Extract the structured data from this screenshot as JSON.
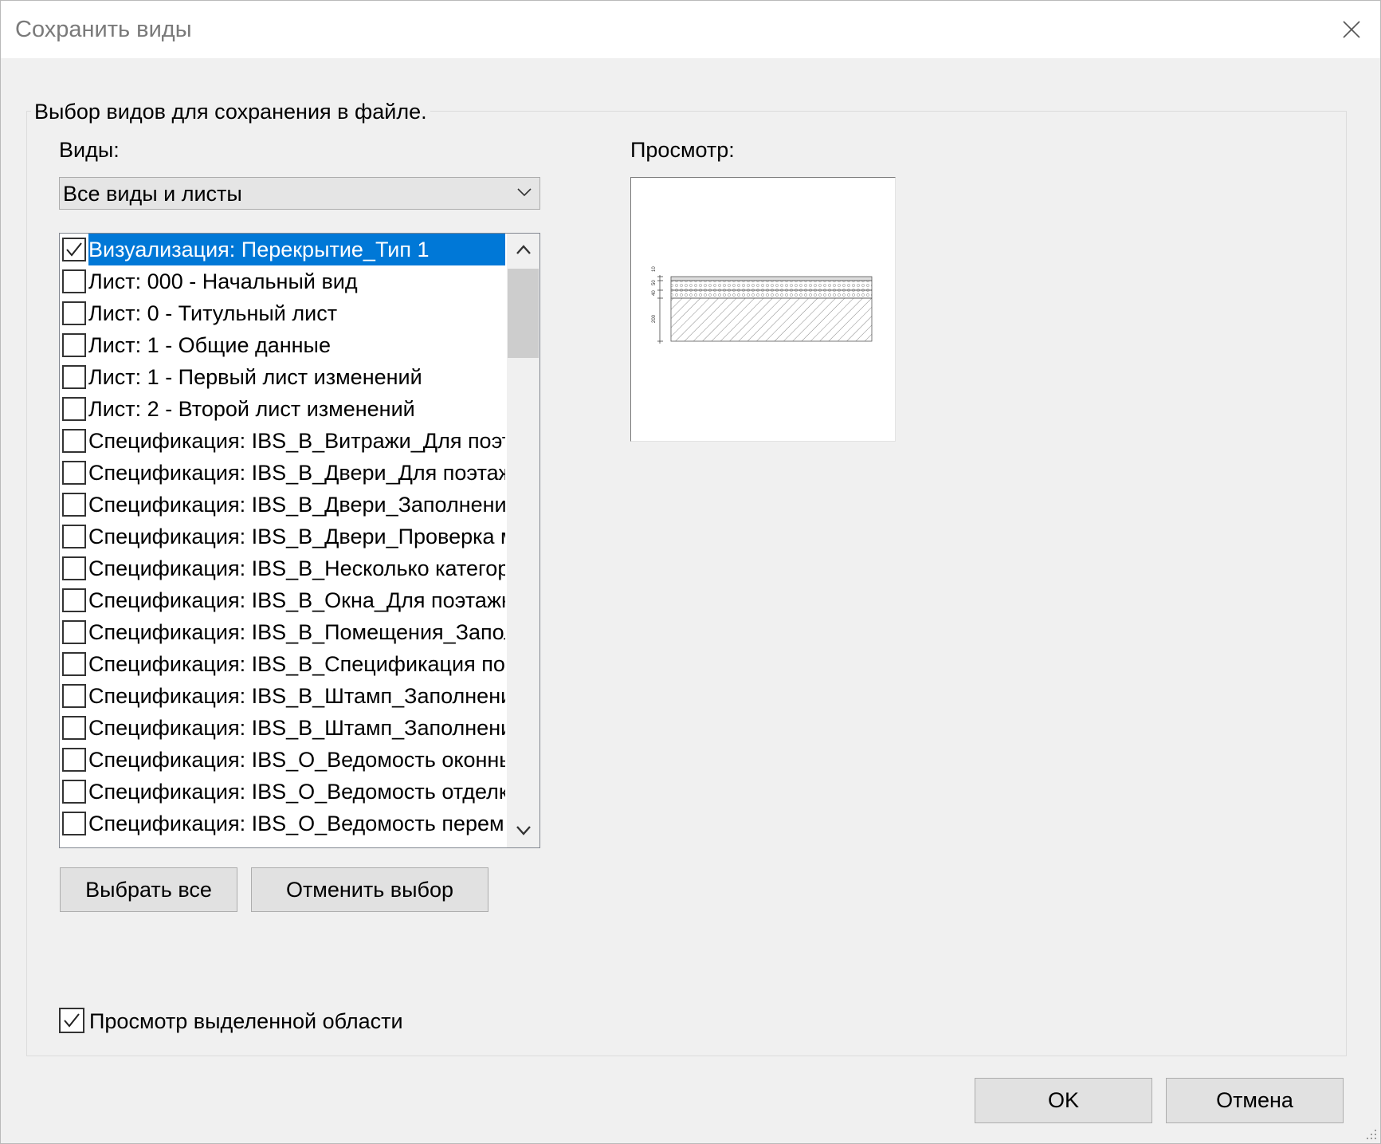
{
  "window": {
    "title": "Сохранить виды"
  },
  "group": {
    "caption": "Выбор видов для сохранения в файле."
  },
  "views": {
    "label": "Виды:",
    "filter_value": "Все виды и листы",
    "items": [
      {
        "label": "Визуализация: Перекрытие_Тип 1",
        "checked": true,
        "selected": true
      },
      {
        "label": "Лист: 000 - Начальный вид",
        "checked": false
      },
      {
        "label": "Лист: 0 - Титульный лист",
        "checked": false
      },
      {
        "label": "Лист: 1 - Общие данные",
        "checked": false
      },
      {
        "label": "Лист: 1 - Первый лист изменений",
        "checked": false
      },
      {
        "label": "Лист: 2 - Второй лист изменений",
        "checked": false
      },
      {
        "label": "Спецификация: IBS_В_Витражи_Для поэта",
        "checked": false
      },
      {
        "label": "Спецификация: IBS_В_Двери_Для поэтажн",
        "checked": false
      },
      {
        "label": "Спецификация: IBS_В_Двери_Заполнение",
        "checked": false
      },
      {
        "label": "Спецификация: IBS_В_Двери_Проверка ма",
        "checked": false
      },
      {
        "label": "Спецификация: IBS_В_Несколько категорий",
        "checked": false
      },
      {
        "label": "Спецификация: IBS_В_Окна_Для поэтажны",
        "checked": false
      },
      {
        "label": "Спецификация: IBS_В_Помещения_Заполн",
        "checked": false
      },
      {
        "label": "Спецификация: IBS_В_Спецификация поме",
        "checked": false
      },
      {
        "label": "Спецификация: IBS_В_Штамп_Заполнение",
        "checked": false
      },
      {
        "label": "Спецификация: IBS_В_Штамп_Заполнение",
        "checked": false
      },
      {
        "label": "Спецификация: IBS_О_Ведомость оконных",
        "checked": false
      },
      {
        "label": "Спецификация: IBS_О_Ведомость отделки",
        "checked": false
      },
      {
        "label": "Спецификация: IBS_О_Ведомость перемы",
        "checked": false
      }
    ],
    "select_all_label": "Выбрать все",
    "deselect_label": "Отменить выбор"
  },
  "preview": {
    "label": "Просмотр:",
    "dim_labels": [
      "10",
      "50",
      "40",
      "200"
    ]
  },
  "preview_selection": {
    "label": "Просмотр выделенной области",
    "checked": true
  },
  "footer": {
    "ok_label": "OK",
    "cancel_label": "Отмена"
  },
  "colors": {
    "selection": "#0078d7",
    "background": "#f0f0f0"
  }
}
